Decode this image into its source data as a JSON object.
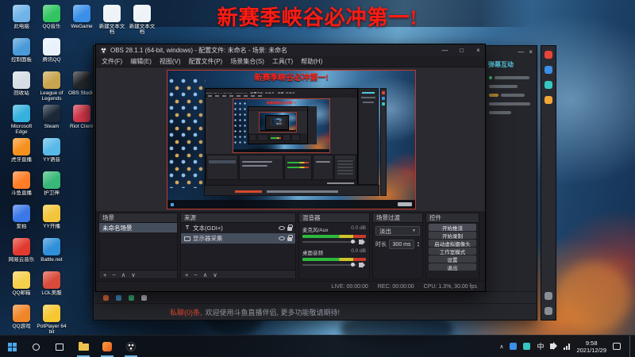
{
  "banner": {
    "text": "新赛季峡谷必冲第一!"
  },
  "desktop": {
    "icons": [
      {
        "label": "此电脑",
        "color": "#6fb3e8",
        "col": 0,
        "row": 0
      },
      {
        "label": "QQ音乐",
        "color": "#31c461",
        "col": 1,
        "row": 0
      },
      {
        "label": "WeGame",
        "color": "#3a8fe8",
        "col": 2,
        "row": 0
      },
      {
        "label": "新建文本文档",
        "color": "#eef3f8",
        "col": 3,
        "row": 0
      },
      {
        "label": "新建文本文档",
        "color": "#eef3f8",
        "col": 4,
        "row": 0
      },
      {
        "label": "控制面板",
        "color": "#4a9ad9",
        "col": 0,
        "row": 1
      },
      {
        "label": "腾讯QQ",
        "color": "#e9f2fa",
        "col": 1,
        "row": 1
      },
      {
        "label": "回收站",
        "color": "#d6dde4",
        "col": 0,
        "row": 2
      },
      {
        "label": "League of Legends",
        "color": "#c9a44e",
        "col": 1,
        "row": 2
      },
      {
        "label": "OBS Studio",
        "color": "#24282c",
        "col": 2,
        "row": 2
      },
      {
        "label": "Microsoft Edge",
        "color": "#35b1dd",
        "col": 0,
        "row": 3
      },
      {
        "label": "Steam",
        "color": "#1b2838",
        "col": 1,
        "row": 3
      },
      {
        "label": "Riot Client",
        "color": "#d8384b",
        "col": 2,
        "row": 3
      },
      {
        "label": "虎牙直播",
        "color": "#f7911e",
        "col": 0,
        "row": 4
      },
      {
        "label": "YY语音",
        "color": "#58b9e8",
        "col": 1,
        "row": 4
      },
      {
        "label": "斗鱼直播",
        "color": "#ff7d26",
        "col": 0,
        "row": 5
      },
      {
        "label": "护卫神",
        "color": "#38b878",
        "col": 1,
        "row": 5
      },
      {
        "label": "爱拍",
        "color": "#3a77e8",
        "col": 0,
        "row": 6
      },
      {
        "label": "YY开播",
        "color": "#f3c53a",
        "col": 1,
        "row": 6
      },
      {
        "label": "网易云音乐",
        "color": "#e23a2f",
        "col": 0,
        "row": 7
      },
      {
        "label": "Battle.net",
        "color": "#2f8fd8",
        "col": 1,
        "row": 7
      },
      {
        "label": "QQ邮箱",
        "color": "#f5d04d",
        "col": 0,
        "row": 8
      },
      {
        "label": "LOL美服",
        "color": "#d84a3a",
        "col": 1,
        "row": 8
      },
      {
        "label": "QQ游戏",
        "color": "#f0862a",
        "col": 0,
        "row": 9
      },
      {
        "label": "PotPlayer 64 bit",
        "color": "#f5c832",
        "col": 1,
        "row": 9
      }
    ]
  },
  "obs": {
    "title": "OBS 28.1.1 (64-bit, windows) - 配置文件: 未命名 - 场景: 未命名",
    "window_buttons": {
      "min": "—",
      "max": "□",
      "close": "×"
    },
    "menus": [
      "文件(F)",
      "编辑(E)",
      "视图(V)",
      "配置文件(P)",
      "场景集合(S)",
      "工具(T)",
      "帮助(H)"
    ],
    "scenes": {
      "title": "场景",
      "items": [
        "未命名场景"
      ]
    },
    "sources": {
      "title": "来源",
      "items": [
        {
          "label": "文本(GDI+)",
          "type": "text",
          "glyph": "T"
        },
        {
          "label": "显示器采集",
          "type": "display",
          "glyph": ""
        }
      ]
    },
    "dock_toolbar": {
      "add": "+",
      "remove": "−",
      "up": "∧",
      "down": "∨"
    },
    "mixer": {
      "title": "混音器",
      "channels": [
        {
          "name": "麦克风/Aux",
          "db": "0.0 dB"
        },
        {
          "name": "桌面音频",
          "db": "0.0 dB"
        }
      ]
    },
    "transitions": {
      "title": "场景过渡",
      "selected": "淡出",
      "caret": "▼",
      "duration_label": "时长",
      "duration": "300 ms",
      "spin_up": "▲",
      "spin_down": "▼"
    },
    "controls": {
      "title": "控件",
      "buttons": [
        "开始推流",
        "开始录制",
        "启动虚拟摄像头",
        "工作室模式",
        "设置",
        "退出"
      ]
    },
    "status": {
      "live": "LIVE: 00:00:00",
      "rec": "REC: 00:00:00",
      "cpu": "CPU: 1.3%, 30.00 fps"
    }
  },
  "companion": {
    "panel_title": "弹幕互动",
    "panel_buttons": {
      "min": "—",
      "close": "×"
    },
    "bottom": {
      "highlight": "私聊(0)条,",
      "notice": "欢迎使用斗鱼直播伴侣, 更多功能敬请期待!"
    }
  },
  "taskbar": {
    "time": "9:58",
    "date": "2021/12/29",
    "input_indicator": "中"
  }
}
